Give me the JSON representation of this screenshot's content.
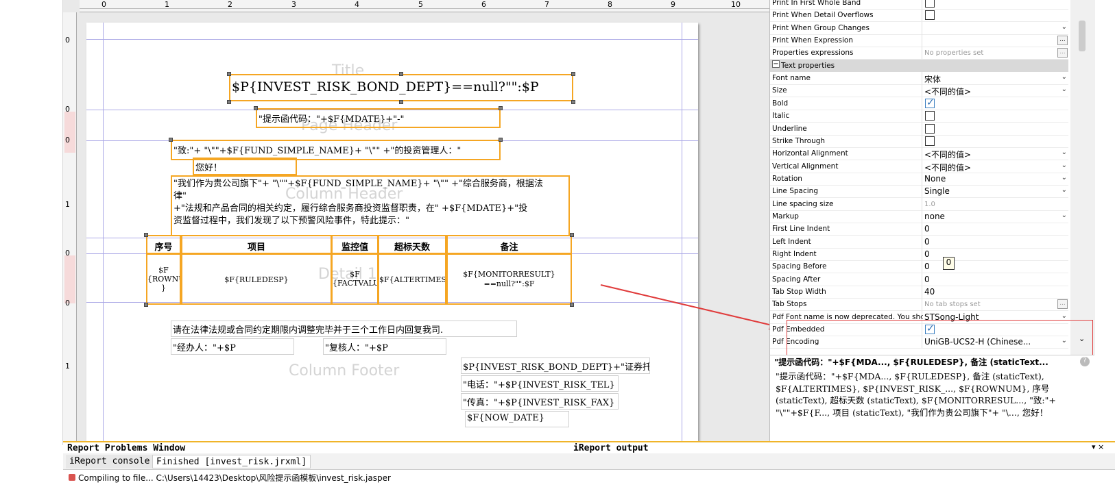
{
  "ruler": {
    "h_labels": [
      "0",
      "1",
      "2",
      "3",
      "4",
      "5",
      "6",
      "7",
      "8",
      "9",
      "10"
    ],
    "v_labels": [
      "0",
      "0",
      "0",
      "1",
      "0",
      "0",
      "1"
    ]
  },
  "bands": {
    "title": "Title",
    "page_header": "Page Header",
    "column_header": "Column Header",
    "detail": "Detail 1",
    "column_footer": "Column Footer"
  },
  "elements": {
    "title_expr": "$P{INVEST_RISK_BOND_DEPT}==null?\"\":$P",
    "hint_code": "\"提示函代码：\"+$F{MDATE}+\"-\"",
    "greeting_to": "\"致:\"+ \"\\\"\"+$F{FUND_SIMPLE_NAME}+ \"\\\"\" +\"的投资管理人：\"",
    "hello": "您好！",
    "para_line1": "\"我们作为贵公司旗下\"+ \"\\\"\"+$F{FUND_SIMPLE_NAME}+ \"\\\"\" +\"综合服务商，根据法",
    "para_line2": "律\"",
    "para_line3": "+\"法规和产品合同的相关约定，履行综合服务商投资监督职责，在\" +$F{MDATE}+\"投",
    "para_line4": "资监督过程中，我们发现了以下预警风险事件，特此提示：\"",
    "col_seq": "序号",
    "col_item": "项目",
    "col_monitor": "监控值",
    "col_days": "超标天数",
    "col_remark": "备注",
    "d_seq_1": "$F",
    "d_seq_2": "{ROWNUM",
    "d_seq_3": "}",
    "d_item": "$F{RULEDESP}",
    "d_factvalue_1": "$F",
    "d_factvalue_2": "{FACTVALUE",
    "d_alter": "$F{ALTERTIMES}",
    "d_remark_1": "$F{MONITORRESULT}",
    "d_remark_2": "==null?\"\":$F",
    "footer_notice": "请在法律法规或合同约定期限内调整完毕并于三个工作日内回复我司.",
    "handler": "\"经办人：\"+$P",
    "reviewer": "\"复核人：\"+$P",
    "custody": "$P{INVEST_RISK_BOND_DEPT}+\"证券托管",
    "tel": "\"电话：\"+$P{INVEST_RISK_TEL}",
    "fax": "\"传真：\"+$P{INVEST_RISK_FAX}",
    "now_date": "$F{NOW_DATE}"
  },
  "properties": {
    "rows_top": [
      {
        "name": "Print In First Whole Band",
        "type": "checkbox",
        "checked": false
      },
      {
        "name": "Print When Detail Overflows",
        "type": "checkbox",
        "checked": false
      },
      {
        "name": "Print When Group Changes",
        "type": "dropdown",
        "value": ""
      },
      {
        "name": "Print When Expression",
        "type": "ellipsis",
        "value": ""
      },
      {
        "name": "Properties expressions",
        "type": "ellipsis-gray",
        "value": "No properties set"
      }
    ],
    "section_label": "Text properties",
    "section_toggle": "−",
    "rows": [
      {
        "name": "Font name",
        "type": "dropdown",
        "value": "宋体"
      },
      {
        "name": "Size",
        "type": "dropdown",
        "value": "<不同的值>"
      },
      {
        "name": "Bold",
        "type": "checkbox",
        "checked": true
      },
      {
        "name": "Italic",
        "type": "checkbox",
        "checked": false
      },
      {
        "name": "Underline",
        "type": "checkbox",
        "checked": false
      },
      {
        "name": "Strike Through",
        "type": "checkbox",
        "checked": false
      },
      {
        "name": "Horizontal Alignment",
        "type": "dropdown",
        "value": "<不同的值>"
      },
      {
        "name": "Vertical Alignment",
        "type": "dropdown",
        "value": "<不同的值>"
      },
      {
        "name": "Rotation",
        "type": "dropdown",
        "value": "None"
      },
      {
        "name": "Line Spacing",
        "type": "dropdown",
        "value": "Single"
      },
      {
        "name": "Line spacing size",
        "type": "gray",
        "value": "1.0"
      },
      {
        "name": "Markup",
        "type": "dropdown",
        "value": "none"
      },
      {
        "name": "First Line Indent",
        "type": "text",
        "value": "0"
      },
      {
        "name": "Left Indent",
        "type": "text",
        "value": "0"
      },
      {
        "name": "Right Indent",
        "type": "text",
        "value": "0"
      },
      {
        "name": "Spacing Before",
        "type": "text",
        "value": "0"
      },
      {
        "name": "Spacing After",
        "type": "text",
        "value": "0"
      },
      {
        "name": "Tab Stop Width",
        "type": "text",
        "value": "40"
      },
      {
        "name": "Tab Stops",
        "type": "ellipsis-gray",
        "value": "No tab stops set"
      },
      {
        "name": "Pdf Font name is now deprecated. You should",
        "type": "dropdown",
        "value": "STSong-Light"
      },
      {
        "name": "Pdf Embedded",
        "type": "checkbox",
        "checked": true
      },
      {
        "name": "Pdf Encoding",
        "type": "dropdown",
        "value": "UniGB-UCS2-H (Chinese..."
      }
    ],
    "tooltip_value": "0"
  },
  "description": {
    "title": "\"提示函代码：\"+$F{MDA..., $F{RULEDESP}, 备注 (staticText...",
    "help_icon": "?",
    "body": "\"提示函代码：\"+$F{MDA..., $F{RULEDESP}, 备注 (staticText), $F{ALTERTIMES}, $P{INVEST_RISK_..., $F{ROWNUM}, 序号 (staticText), 超标天数 (staticText), $F{MONITORRESUL..., \"致:\"+ \"\\\"\"+$F{F..., 项目 (staticText), \"我们作为贵公司旗下\"+ \"\\..., 您好！"
  },
  "bottom": {
    "problems_title": "Report Problems Window",
    "output_title": "iReport output",
    "tab_console": "iReport console",
    "tab_finished": "Finished [invest_risk.jrxml]",
    "compile_msg": "Compiling to file... C:\\Users\\14423\\Desktop\\风险提示函模板\\invest_risk.jasper",
    "panel_controls": "▾ ×"
  },
  "colors": {
    "selection": "#f5a623",
    "guide": "#aaa8e6",
    "annotation": "#e03b3b"
  }
}
